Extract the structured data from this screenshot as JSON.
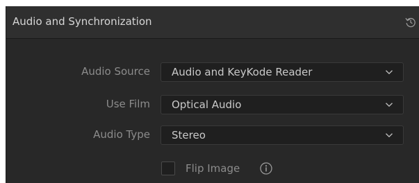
{
  "panel": {
    "title": "Audio and Synchronization",
    "reset_icon": "reset-icon"
  },
  "fields": [
    {
      "label": "Audio Source",
      "value": "Audio and KeyKode Reader"
    },
    {
      "label": "Use Film",
      "value": "Optical Audio"
    },
    {
      "label": "Audio Type",
      "value": "Stereo"
    }
  ],
  "flip_image": {
    "label": "Flip Image",
    "checked": false,
    "info_icon": "info-icon"
  },
  "colors": {
    "panel_bg": "#282828",
    "header_bg": "#2f2f2f",
    "field_bg": "#1f1f1f",
    "label_text": "#8c8c8c",
    "value_text": "#c9c9c9"
  }
}
